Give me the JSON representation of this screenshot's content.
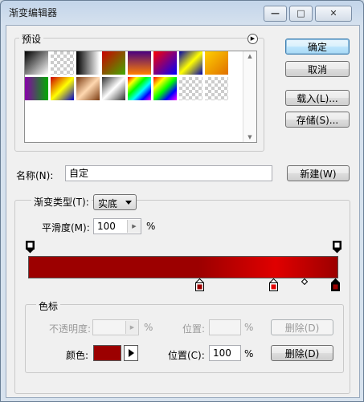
{
  "window": {
    "title": "渐变编辑器",
    "minimize_glyph": "—",
    "maximize_glyph": "□",
    "close_glyph": "✕"
  },
  "presets": {
    "label": "预设",
    "menu_glyph": "▶"
  },
  "buttons": {
    "ok": "确定",
    "cancel": "取消",
    "load": "载入(L)...",
    "save": "存储(S)...",
    "new": "新建(W)"
  },
  "name": {
    "label": "名称(N):",
    "value": "自定"
  },
  "gradient_type": {
    "label": "渐变类型(T):",
    "value": "实底"
  },
  "smoothness": {
    "label": "平滑度(M):",
    "value": "100",
    "unit": "%"
  },
  "color_stops": {
    "label": "色标",
    "opacity_label": "不透明度:",
    "opacity_unit": "%",
    "opacity_location_label": "位置:",
    "opacity_location_unit": "%",
    "delete_opacity": "删除(D)",
    "color_label": "颜色:",
    "location_label": "位置(C):",
    "location_value": "100",
    "location_unit": "%",
    "delete_color": "删除(D)"
  },
  "colors": {
    "gradient_start": "#9c0000",
    "gradient_mid": "#e00000",
    "gradient_end": "#9c0000",
    "selected_color": "#9c0000"
  },
  "scroll": {
    "up": "▲",
    "down": "▼"
  }
}
